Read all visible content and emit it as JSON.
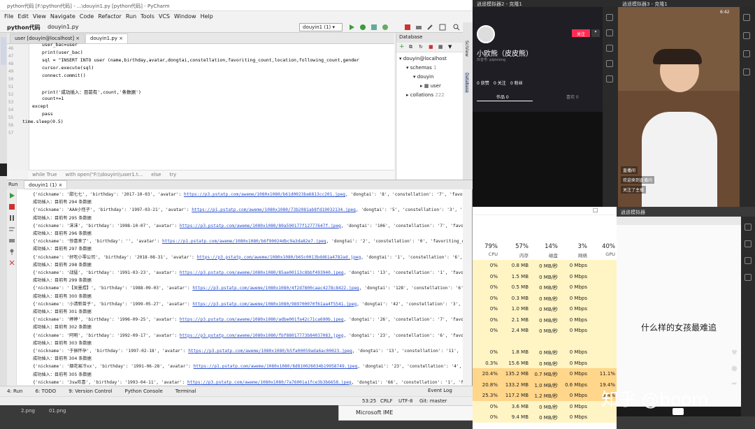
{
  "ide": {
    "title": "python代码 [F:\\python代码] - ...\\douyin1.py [python代码] - PyCharm",
    "menu": [
      "File",
      "Edit",
      "View",
      "Navigate",
      "Code",
      "Refactor",
      "Run",
      "Tools",
      "VCS",
      "Window",
      "Help"
    ],
    "project": "python代码",
    "file": "douyin1.py",
    "run_config": "douyin1 (1)",
    "editor_tabs": [
      "user [douyin@localhost]",
      "douyin1.py"
    ],
    "line_numbers": [
      "46",
      "47",
      "48",
      "49",
      "50",
      "51",
      "52",
      "53",
      "54",
      "55",
      "56",
      "57"
    ],
    "code_lines": [
      "user_bac=user",
      "print(user_bac)",
      "sql = \"INSERT INTO user (name,birthday,avatar,dongtai,constellation,favoriting_count,location,following_count,gender",
      "cursor.execute(sql)",
      "connect.commit()",
      "",
      "print('成功插入：目前有',count,'条数据')",
      "count+=1",
      "except",
      "pass",
      "time.sleep(0.5)"
    ],
    "breadcrumb": [
      "while True",
      "with open(\"F:\\\\douyin\\\\user1.t...",
      "else",
      "try"
    ]
  },
  "database": {
    "title": "Database",
    "connection": "douyin@localhost",
    "schemas": "schemas",
    "schema_count": "1",
    "db": "douyin",
    "table": "user",
    "collations": "collations",
    "collation_count": "222",
    "side_tabs": [
      "SciView",
      "Database"
    ]
  },
  "run": {
    "label": "Run",
    "tab": "douyin1 (1)",
    "lines": [
      {
        "nick": "{'nickname': '甜七七', 'birthday': '2017-10-03', 'avatar': ",
        "url": "https://p3.pstatp.com/aweme/1080x1080/b61d0023ba6813cc201.jpeg",
        "rest": ", 'dongtai': '8', 'constellation': '7', 'favoriting_"
      },
      {
        "text": "成功插入：目前有 294 条数据"
      },
      {
        "nick": "{'nickname': 'AAA小怪子', 'birthday': '1997-03-21', 'avatar': ",
        "url": "https://p1.pstatp.com/aweme/1080x1080/73b2081ab8fd19032134.jpeg",
        "rest": ", 'dongtai': '5', 'constellation': '3', 'favoriti"
      },
      {
        "text": "成功插入：目前有 295 条数据"
      },
      {
        "nick": "{'nickname': '沫沫', 'birthday': '1998-10-07', 'avatar': ",
        "url": "https://p3.pstatp.com/aweme/1080x1080/80a590177f12777647f.jpeg",
        "rest": ", 'dongtai': '106', 'constellation': '7', 'favoriting_"
      },
      {
        "text": "成功插入：目前有 296 条数据"
      },
      {
        "nick": "{'nickname': '惊喜来了', 'birthday': '', 'avatar': ",
        "url": "https://p1.pstatp.com/aweme/1080x1080/b6f90024dbc9a3da82e7.jpeg",
        "rest": ", 'dongtai': '2', 'constellation': '0', 'favoriting_count'"
      },
      {
        "text": "成功插入：目前有 297 条数据"
      },
      {
        "nick": "{'nickname': '好吃小零公司', 'birthday': '2018-08-31', 'avatar': ",
        "url": "https://p3.pstatp.com/aweme/1080x1080/b65c0013bdd61a4782ad.jpeg",
        "rest": ", 'dongtai': '1', 'constellation': '6', 'favor"
      },
      {
        "text": "成功插入：目前有 298 条数据"
      },
      {
        "nick": "{'nickname': '战猛', 'birthday': '1991-03-23', 'avatar': ",
        "url": "https://p3.pstatp.com/aweme/1080x1080/85ae00113c8bbf493940.jpeg",
        "rest": ", 'dongtai': '13', 'constellation': '1', 'favoriting_c"
      },
      {
        "text": "成功插入：目前有 299 条数据"
      },
      {
        "nick": "{'nickname': '【吴墨煜】', 'birthday': '1988-09-03', 'avatar': ",
        "url": "https://p3.pstatp.com/aweme/1080x1080/4f2d7800caac4278c8422.jpeg",
        "rest": ", 'dongtai': '128', 'constellation': '6', 'favor"
      },
      {
        "text": "成功插入：目前有 300 条数据"
      },
      {
        "nick": "{'nickname': '小清新苗子', 'birthday': '1999-05-27', 'avatar': ",
        "url": "https://p3.pstatp.com/aweme/1080x1080/989700070f61aa4f5541.jpeg",
        "rest": ", 'dongtai': '42', 'constellation': '3', 'favori"
      },
      {
        "text": "成功插入：目前有 301 条数据"
      },
      {
        "nick": "{'nickname': '婷婷', 'birthday': '1996-09-25', 'avatar': ",
        "url": "https://p3.pstatp.com/aweme/1080x1080/adbe001fa42c71ca690b.jpeg",
        "rest": ", 'dongtai': '26', 'constellation': '7', 'favoriting_"
      },
      {
        "text": "成功插入：目前有 302 条数据"
      },
      {
        "nick": "{'nickname': '阿明', 'birthday': '1992-09-17', 'avatar': ",
        "url": "https://p3.pstatp.com/aweme/1080x1080/fbf88017773b84037083.jpeg",
        "rest": ", 'dongtai': '23', 'constellation': '6', 'favoriting_c"
      },
      {
        "text": "成功插入：目前有 303 条数据"
      },
      {
        "nick": "{'nickname': '于振怀孕', 'birthday': '1997-02-18', 'avatar': ",
        "url": "https://p3.pstatp.com/aweme/1080x1080/b5fa00059ada6ac00023.jpeg",
        "rest": ", 'dongtai': '13', 'constellation': '11', 'favorit"
      },
      {
        "text": "成功插入：目前有 304 条数据"
      },
      {
        "nick": "{'nickname': '烟花易冷xx', 'birthday': '1991-06-28', 'avatar': ",
        "url": "https://p1.pstatp.com/aweme/1080x1080/8d810026034b19958749.jpeg",
        "rest": ", 'dongtai': '23', 'constellation': '4', 'favori"
      },
      {
        "text": "成功插入：目前有 305 条数据"
      },
      {
        "nick": "{'nickname': '3sw欢喜', 'birthday': '1993-04-11', 'avatar': ",
        "url": "https://p3.pstatp.com/aweme/1080x1080/7a76001a1fce3b3b6658.jpeg",
        "rest": ", 'dongtai': '66', 'constellation': '1', 'favoriti"
      },
      {
        "text": "成功插入：目前有 306 条数据"
      }
    ]
  },
  "bottom_tabs": [
    "4: Run",
    "6: TODO",
    "9: Version Control",
    "Python Console",
    "Terminal"
  ],
  "event_log": "Event Log",
  "status": {
    "position": "53:25",
    "crlf": "CRLF",
    "encoding": "UTF-8",
    "git": "Git: master"
  },
  "taskbar_files": [
    "2.png",
    "01.png"
  ],
  "emulator1": {
    "title": "逍遥模拟器2 - 克隆1",
    "name": "小欧熊（皮皮熊）",
    "id": "抖音号: pipixiong",
    "follow": "关注",
    "stats": [
      "0 获赞",
      "0 关注",
      "0 粉丝"
    ],
    "tabs": [
      "作品 0",
      "喜欢 0"
    ]
  },
  "emulator2": {
    "title": "逍遥模拟器3 - 克隆1",
    "time": "6:42",
    "comments": [
      "直播间",
      "欢迎来到直播间",
      "关注了主播"
    ]
  },
  "taskmgr": {
    "headers": [
      {
        "pct": "79%",
        "label": "CPU"
      },
      {
        "pct": "57%",
        "label": "内存"
      },
      {
        "pct": "14%",
        "label": "磁盘"
      },
      {
        "pct": "3%",
        "label": "网络"
      },
      {
        "pct": "40%",
        "label": "GPU"
      }
    ],
    "rows": [
      [
        "0%",
        "0.8 MB",
        "0 MB/秒",
        "0 Mbps",
        ""
      ],
      [
        "0%",
        "1.5 MB",
        "0 MB/秒",
        "0 Mbps",
        ""
      ],
      [
        "0%",
        "0.5 MB",
        "0 MB/秒",
        "0 Mbps",
        ""
      ],
      [
        "0%",
        "0.3 MB",
        "0 MB/秒",
        "0 Mbps",
        ""
      ],
      [
        "0%",
        "1.0 MB",
        "0 MB/秒",
        "0 Mbps",
        ""
      ],
      [
        "0%",
        "2.1 MB",
        "0 MB/秒",
        "0 Mbps",
        ""
      ],
      [
        "0%",
        "2.4 MB",
        "0 MB/秒",
        "0 Mbps",
        ""
      ],
      [
        "",
        "",
        "",
        "",
        ""
      ],
      [
        "0%",
        "1.8 MB",
        "0 MB/秒",
        "0 Mbps",
        ""
      ],
      [
        "0.3%",
        "15.6 MB",
        "0 MB/秒",
        "0 Mbps",
        ""
      ],
      [
        "20.4%",
        "135.2 MB",
        "0.7 MB/秒",
        "0 Mbps",
        "11.1%"
      ],
      [
        "20.8%",
        "133.2 MB",
        "1.0 MB/秒",
        "0.6 Mbps",
        "19.4%"
      ],
      [
        "25.3%",
        "117.2 MB",
        "1.2 MB/秒",
        "0 Mbps",
        "9.4%"
      ],
      [
        "0%",
        "3.6 MB",
        "0 MB/秒",
        "0 Mbps",
        ""
      ],
      [
        "0%",
        "9.4 MB",
        "0 MB/秒",
        "0 Mbps",
        ""
      ]
    ]
  },
  "emulator3": {
    "title": "逍遥模拟器",
    "caption": "什么样的女孩最难追"
  },
  "ime": "Microsoft IME",
  "watermark": "知乎 @boom"
}
